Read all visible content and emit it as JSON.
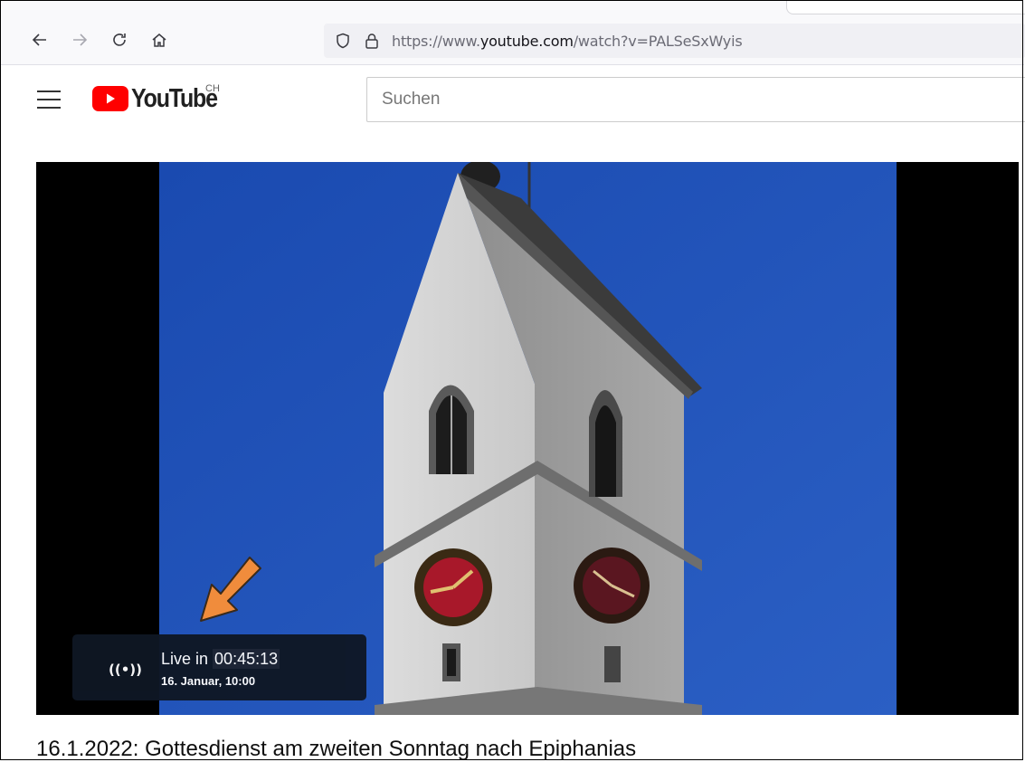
{
  "browser": {
    "url_prefix": "https://www.",
    "url_host": "youtube.com",
    "url_path": "/watch?v=PALSeSxWyis"
  },
  "header": {
    "logo_text": "YouTube",
    "region": "CH",
    "search_placeholder": "Suchen"
  },
  "player": {
    "live_icon": "((•))",
    "live_prefix": "Live in ",
    "countdown": "00:45:13",
    "scheduled": "16. Januar, 10:00"
  },
  "video": {
    "title": "16.1.2022: Gottesdienst am zweiten Sonntag nach Epiphanias"
  },
  "colors": {
    "yt_red": "#ff0000",
    "sky": "#1f4fae",
    "arrow": "#f08c3c"
  },
  "icons": [
    "back-arrow-icon",
    "forward-arrow-icon",
    "reload-icon",
    "home-icon",
    "shield-icon",
    "lock-icon",
    "menu-icon",
    "play-icon",
    "live-broadcast-icon"
  ]
}
